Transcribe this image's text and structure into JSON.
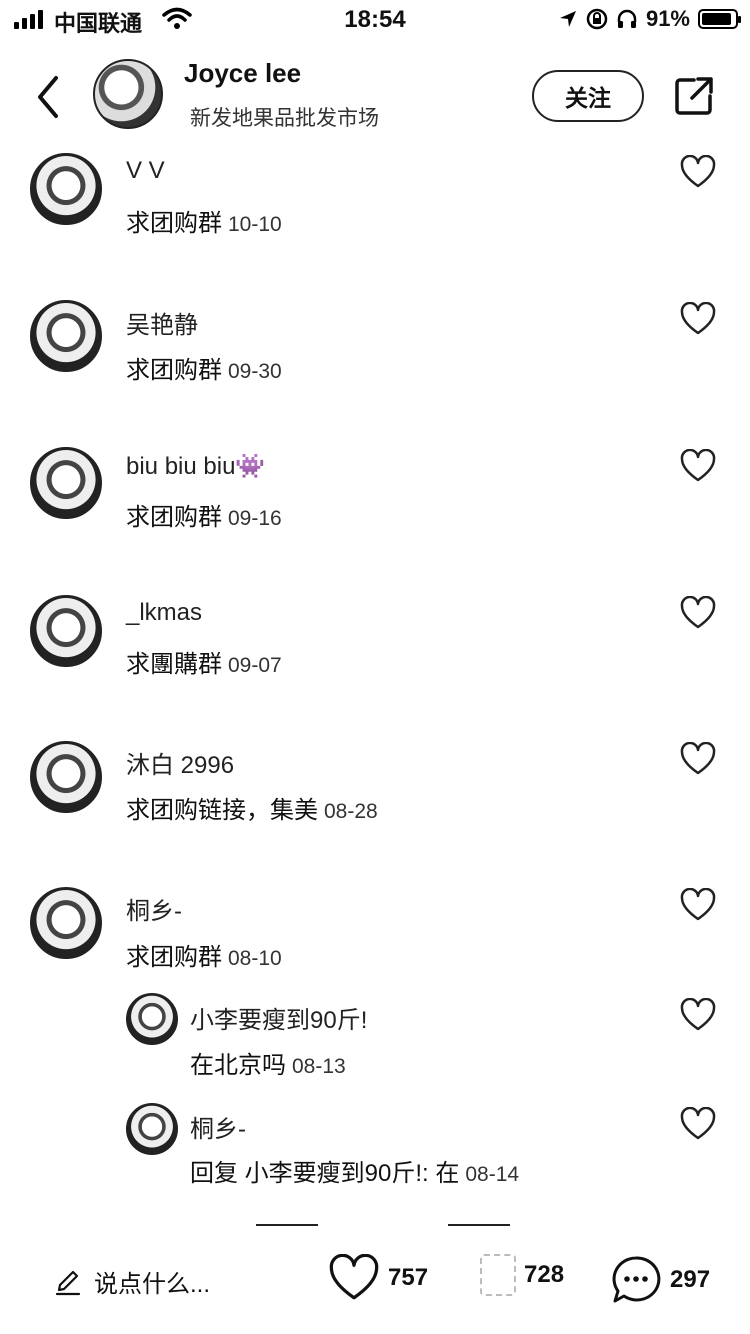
{
  "status_bar": {
    "carrier": "中国联通",
    "time": "18:54",
    "battery_text": "91%",
    "battery_level": 0.91
  },
  "header": {
    "username": "Joyce lee",
    "subtitle": "新发地果品批发市场",
    "follow_label": "关注"
  },
  "comments": [
    {
      "name": "V V",
      "text": "求团购群",
      "date": "10-10"
    },
    {
      "name": "吴艳静",
      "text": "求团购群",
      "date": "09-30"
    },
    {
      "name": "biu biu biu👾",
      "text": "求团购群",
      "date": "09-16"
    },
    {
      "name": "_lkmas",
      "text": "求團購群",
      "date": "09-07"
    },
    {
      "name": "沐白 2996",
      "text": "求团购链接，集美",
      "date": "08-28"
    },
    {
      "name": "桐乡-",
      "text": "求团购群",
      "date": "08-10"
    }
  ],
  "replies": [
    {
      "name": "小李要瘦到90斤!",
      "text": "在北京吗",
      "date": "08-13"
    },
    {
      "name": "桐乡-",
      "text": "回复 小李要瘦到90斤!: 在",
      "date": "08-14"
    }
  ],
  "bottom_bar": {
    "compose_placeholder": "说点什么...",
    "likes": "757",
    "collects": "728",
    "comments": "297"
  },
  "colors": {
    "text": "#111111",
    "background": "#ffffff"
  },
  "icons": [
    "back-icon",
    "share-icon",
    "heart-icon",
    "pencil-icon",
    "comment-bubble-icon",
    "signal-icon",
    "wifi-icon",
    "location-icon",
    "lock-icon",
    "headphones-icon",
    "battery-icon"
  ]
}
